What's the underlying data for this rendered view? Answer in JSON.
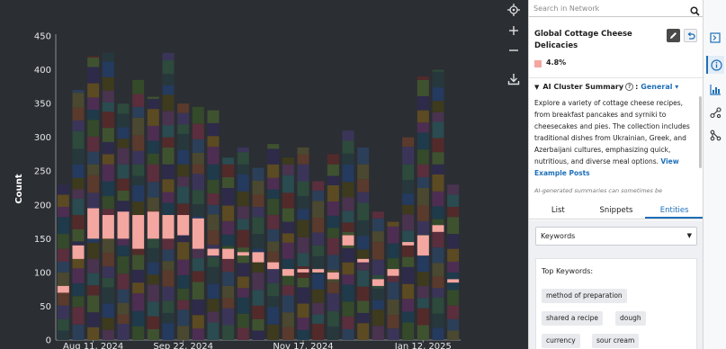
{
  "search": {
    "placeholder": "Search in Network"
  },
  "cluster": {
    "title": "Global Cottage Cheese Delicacies",
    "percent": "4.8%",
    "color": "#f4a6a0"
  },
  "summary": {
    "heading": "AI Cluster Summary",
    "help_symbol": "?",
    "separator": ":",
    "mode": "General",
    "text": "Explore a variety of cottage cheese recipes, from breakfast pancakes and syrniki to cheesecakes and pies. The collection includes traditional dishes from Ukrainian, Greek, and Azerbaijani cultures, emphasizing quick, nutritious, and diverse meal options.",
    "link": "View Example Posts",
    "note": "AI-generated summaries can sometimes be"
  },
  "tabs": [
    {
      "label": "List"
    },
    {
      "label": "Snippets"
    },
    {
      "label": "Entities"
    }
  ],
  "entities": {
    "select_value": "Keywords",
    "card_title": "Top Keywords:",
    "keywords": [
      "method of preparation",
      "shared a recipe",
      "dough",
      "currency",
      "sour cream"
    ]
  },
  "controls": {
    "icons": [
      "crosshair-icon",
      "plus-icon",
      "minus-icon",
      "download-icon"
    ]
  },
  "rail": {
    "icons": [
      "panel-collapse-icon",
      "info-icon",
      "chart-icon",
      "network-icon",
      "share-icon"
    ],
    "active": "info-icon"
  },
  "colors": {
    "accent": "#1e6fb8",
    "chart_bg": "#2b2e33",
    "highlight": "#f4a6a0"
  },
  "chart_data": {
    "type": "bar",
    "stacked": true,
    "ylabel": "Count",
    "ylim": [
      0,
      450
    ],
    "yticks": [
      0,
      50,
      100,
      150,
      200,
      250,
      300,
      350,
      400,
      450
    ],
    "xtick_labels": [
      "Aug 11, 2024",
      "Sep 22, 2024",
      "Nov 17, 2024",
      "Jan 12, 2025"
    ],
    "xtick_index": [
      2,
      8,
      16,
      24
    ],
    "totals": [
      230,
      370,
      420,
      425,
      350,
      385,
      360,
      425,
      350,
      345,
      340,
      270,
      285,
      255,
      290,
      270,
      285,
      235,
      275,
      310,
      285,
      190,
      175,
      300,
      390,
      400,
      230
    ],
    "highlight_series": "Global Cottage Cheese Delicacies",
    "highlight_segments": [
      [
        70,
        80
      ],
      [
        120,
        140
      ],
      [
        150,
        195
      ],
      [
        150,
        185
      ],
      [
        150,
        190
      ],
      [
        135,
        185
      ],
      [
        150,
        190
      ],
      [
        150,
        185
      ],
      [
        155,
        185
      ],
      [
        135,
        180
      ],
      [
        125,
        135
      ],
      [
        120,
        135
      ],
      [
        125,
        130
      ],
      [
        115,
        130
      ],
      [
        105,
        115
      ],
      [
        95,
        105
      ],
      [
        100,
        105
      ],
      [
        100,
        105
      ],
      [
        90,
        100
      ],
      [
        140,
        155
      ],
      [
        115,
        120
      ],
      [
        80,
        90
      ],
      [
        95,
        105
      ],
      [
        140,
        145
      ],
      [
        125,
        155
      ],
      [
        160,
        170
      ],
      [
        85,
        90
      ]
    ]
  }
}
